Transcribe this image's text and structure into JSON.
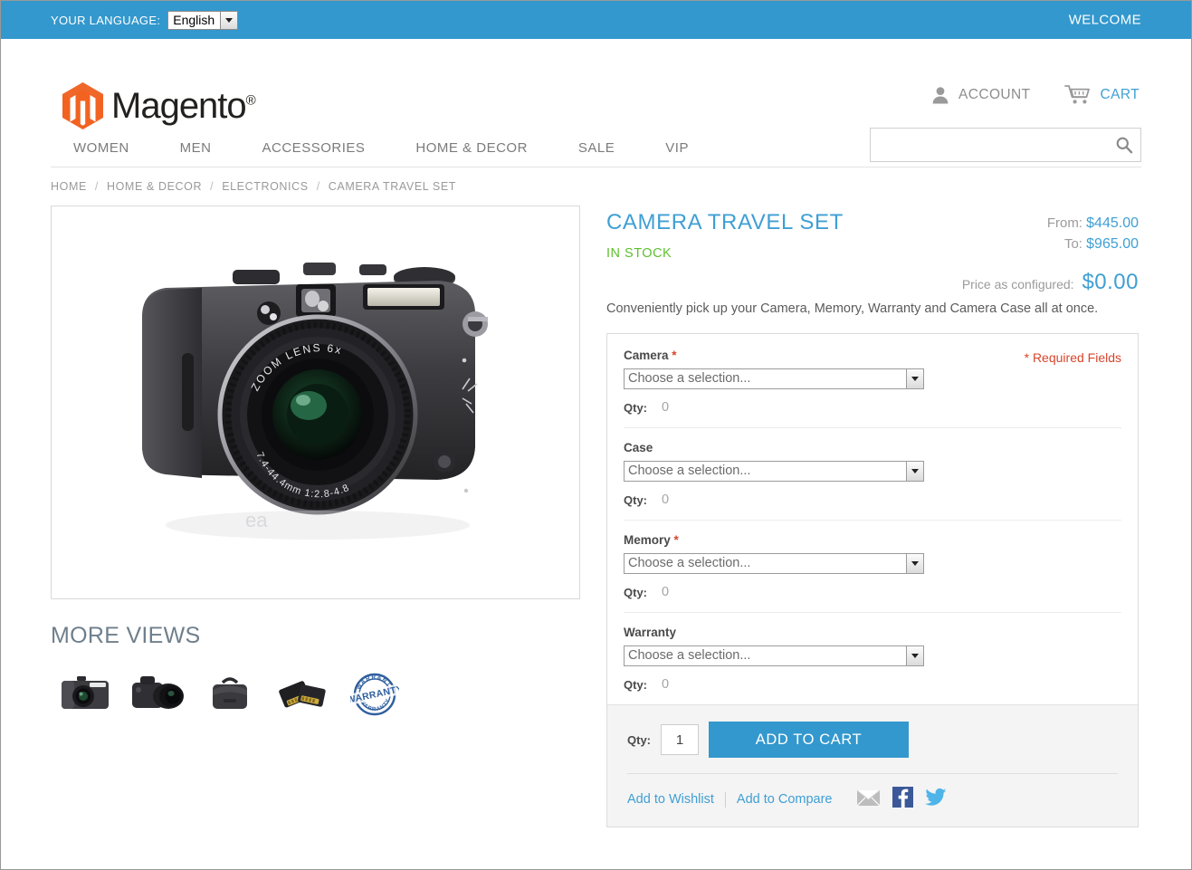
{
  "topbar": {
    "language_label": "YOUR LANGUAGE:",
    "language_value": "English",
    "welcome": "WELCOME"
  },
  "header": {
    "logo_text": "Magento",
    "logo_registered": "®",
    "account_label": "ACCOUNT",
    "cart_label": "CART",
    "search_value": "",
    "search_placeholder": ""
  },
  "nav": {
    "items": [
      {
        "label": "WOMEN"
      },
      {
        "label": "MEN"
      },
      {
        "label": "ACCESSORIES"
      },
      {
        "label": "HOME & DECOR"
      },
      {
        "label": "SALE"
      },
      {
        "label": "VIP"
      }
    ]
  },
  "breadcrumb": {
    "sep": "/",
    "items": [
      {
        "label": "HOME"
      },
      {
        "label": "HOME & DECOR"
      },
      {
        "label": "ELECTRONICS"
      },
      {
        "label": "CAMERA TRAVEL SET"
      }
    ]
  },
  "gallery": {
    "more_views_title": "MORE VIEWS",
    "thumbnails": [
      {
        "name": "compact-camera-front"
      },
      {
        "name": "dslr-camera"
      },
      {
        "name": "camera-bag"
      },
      {
        "name": "sd-memory-cards"
      },
      {
        "name": "warranty-stamp"
      }
    ]
  },
  "product": {
    "title": "CAMERA TRAVEL SET",
    "stock_status": "IN STOCK",
    "price_from_label": "From:",
    "price_from_value": "$445.00",
    "price_to_label": "To:",
    "price_to_value": "$965.00",
    "price_configured_label": "Price as configured:",
    "price_configured_value": "$0.00",
    "description": "Conveniently pick up your Camera, Memory, Warranty and Camera Case all at once."
  },
  "options": {
    "required_note": "* Required Fields",
    "select_placeholder": "Choose a selection...",
    "qty_label": "Qty:",
    "groups": [
      {
        "label": "Camera",
        "required": true,
        "star": "*",
        "selected": "Choose a selection...",
        "qty": "0"
      },
      {
        "label": "Case",
        "required": false,
        "star": "",
        "selected": "Choose a selection...",
        "qty": "0"
      },
      {
        "label": "Memory",
        "required": true,
        "star": "*",
        "selected": "Choose a selection...",
        "qty": "0"
      },
      {
        "label": "Warranty",
        "required": false,
        "star": "",
        "selected": "Choose a selection...",
        "qty": "0"
      }
    ]
  },
  "cart": {
    "qty_label": "Qty:",
    "qty_value": "1",
    "add_to_cart_label": "ADD TO CART",
    "wishlist_label": "Add to Wishlist",
    "compare_label": "Add to Compare",
    "social": [
      {
        "name": "email-icon"
      },
      {
        "name": "facebook-icon"
      },
      {
        "name": "twitter-icon"
      }
    ]
  },
  "colors": {
    "accent_blue": "#3398cd",
    "link_blue": "#3f9fd4",
    "stock_green": "#5fbf2f",
    "required_red": "#d9442b",
    "logo_orange": "#f26322"
  }
}
